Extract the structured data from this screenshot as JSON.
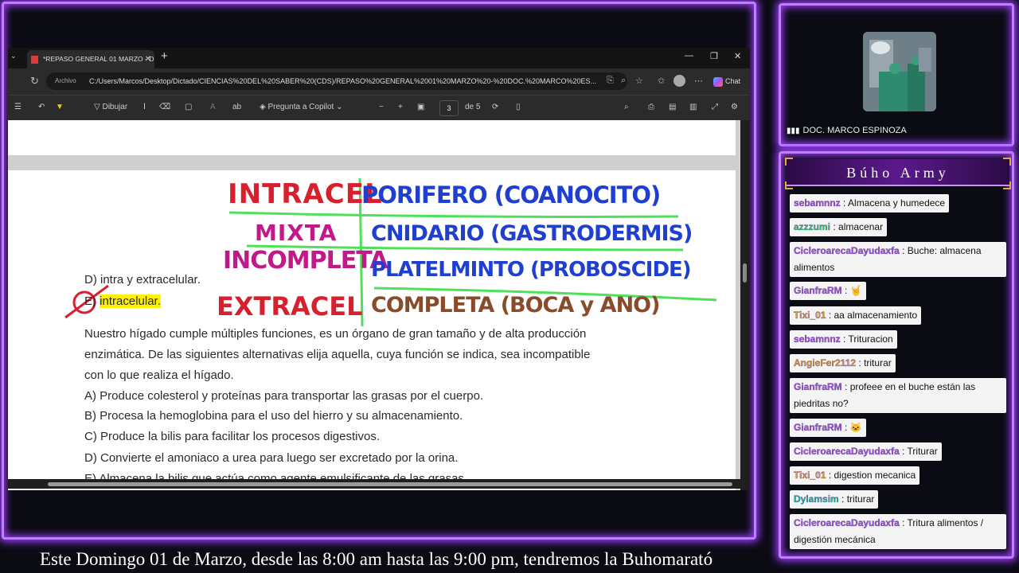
{
  "browser": {
    "tab_title": "*REPASO GENERAL 01 MARZO - D",
    "address_chip": "Archivo",
    "address_url": "C:/Users/Marcos/Desktop/Dictado/CIENCIAS%20DEL%20SABER%20(CDS)/REPASO%20GENERAL%2001%20MARZO%20-%20DOC.%20MARCO%20ES...",
    "copilot_chat": "Chat"
  },
  "pdf_toolbar": {
    "draw_label": "Dibujar",
    "copilot_label": "Pregunta a Copilot",
    "page_number": "3",
    "page_total": "de 5"
  },
  "document": {
    "option_d_prev": "D) intra y extracelular.",
    "option_e_prev": "intracelular.",
    "question_lines": [
      "Nuestro hígado cumple múltiples funciones, es un órgano de gran tamaño y de alta producción",
      "enzimática. De las siguientes alternativas elija aquella, cuya función se indica, sea incompatible",
      "con lo que realiza el hígado."
    ],
    "options": [
      "A) Produce colesterol y proteínas para transportar las grasas por el cuerpo.",
      "B) Procesa la hemoglobina para el uso del hierro y su almacenamiento.",
      "C) Produce la bilis para facilitar los procesos digestivos.",
      "D) Convierte el amoniaco a urea para luego ser excretado por la orina.",
      "E) Almacena la bilis que actúa como agente emulsificante de las grasas."
    ]
  },
  "handwriting": {
    "left": [
      "INTRACEL",
      "MIXTA",
      "INCOMPLETA",
      "EXTRACEL"
    ],
    "right": [
      "PORIFERO (COANOCITO)",
      "CNIDARIO (GASTRODERMIS)",
      "PLATELMINTO (PROBOSCIDE)",
      "COMPLETA (BOCA y ANO)"
    ],
    "colors": {
      "red": "#d6202e",
      "blue": "#1f3fd1",
      "magenta": "#c2188a",
      "gray": "#555555",
      "brown": "#8a4b2a",
      "green": "#4fe05a"
    }
  },
  "ticker": "Este Domingo 01 de Marzo, desde las 8:00 am hasta las 9:00 pm, tendremos la Buhomarató",
  "cam": {
    "label": "DOC. MARCO ESPINOZA"
  },
  "chat": {
    "title": "Búho Army",
    "messages": [
      {
        "user": "sebamnnz",
        "text": "Almacena y humedece"
      },
      {
        "user": "azzzumi",
        "text": "almacenar"
      },
      {
        "user": "CicleroarecaDayudaxfa",
        "text": "Buche: almacena alimentos"
      },
      {
        "user": "GianfraRM",
        "text": "🤘"
      },
      {
        "user": "Tixi_01",
        "text": "aa almacenamiento"
      },
      {
        "user": "sebamnnz",
        "text": "Trituracion"
      },
      {
        "user": "AngieFer2112",
        "text": "triturar"
      },
      {
        "user": "GianfraRM",
        "text": "profeee en el buche están las piedritas no?"
      },
      {
        "user": "GianfraRM",
        "text": "🐱"
      },
      {
        "user": "CicleroarecaDayudaxfa",
        "text": "Triturar"
      },
      {
        "user": "Tixi_01",
        "text": "digestion mecanica"
      },
      {
        "user": "Dylamsim",
        "text": "triturar"
      },
      {
        "user": "CicleroarecaDayudaxfa",
        "text": "Tritura alimentos / digestión mecánica"
      }
    ]
  }
}
